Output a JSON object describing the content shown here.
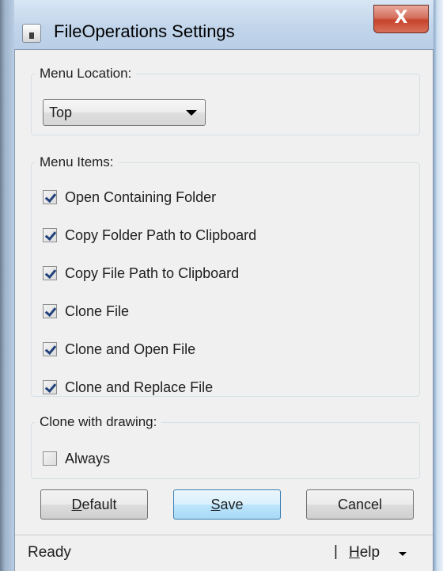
{
  "window": {
    "title": "FileOperations Settings",
    "close_symbol": "X"
  },
  "menu_location": {
    "label": "Menu Location:",
    "selected": "Top"
  },
  "menu_items": {
    "label": "Menu Items:",
    "items": [
      {
        "label": "Open Containing Folder",
        "checked": true
      },
      {
        "label": "Copy Folder Path to Clipboard",
        "checked": true
      },
      {
        "label": "Copy File Path to Clipboard",
        "checked": true
      },
      {
        "label": "Clone File",
        "checked": true
      },
      {
        "label": "Clone and Open File",
        "checked": true
      },
      {
        "label": "Clone and Replace File",
        "checked": true
      }
    ]
  },
  "clone_drawing": {
    "label": "Clone with drawing:",
    "always_label": "Always",
    "always_checked": false
  },
  "buttons": {
    "default": "Default",
    "save": "Save",
    "cancel": "Cancel"
  },
  "status": {
    "text": "Ready",
    "separator": "|",
    "help": "Help"
  }
}
